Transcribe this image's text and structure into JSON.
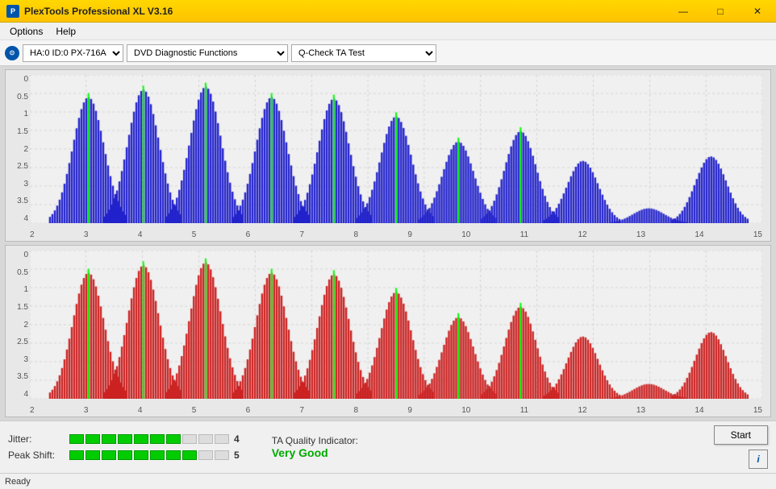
{
  "titleBar": {
    "title": "PlexTools Professional XL V3.16",
    "iconLabel": "P",
    "minimizeBtn": "—",
    "maximizeBtn": "□",
    "closeBtn": "✕"
  },
  "menuBar": {
    "items": [
      "Options",
      "Help"
    ]
  },
  "toolbar": {
    "deviceLabel": "HA:0 ID:0  PX-716A",
    "functionLabel": "DVD Diagnostic Functions",
    "testLabel": "Q-Check TA Test"
  },
  "charts": {
    "topChart": {
      "color": "#0000dd",
      "yLabels": [
        "0",
        "0.5",
        "1",
        "1.5",
        "2",
        "2.5",
        "3",
        "3.5",
        "4"
      ],
      "xLabels": [
        "2",
        "3",
        "4",
        "5",
        "6",
        "7",
        "8",
        "9",
        "10",
        "11",
        "12",
        "13",
        "14",
        "15"
      ]
    },
    "bottomChart": {
      "color": "#dd0000",
      "yLabels": [
        "0",
        "0.5",
        "1",
        "1.5",
        "2",
        "2.5",
        "3",
        "3.5",
        "4"
      ],
      "xLabels": [
        "2",
        "3",
        "4",
        "5",
        "6",
        "7",
        "8",
        "9",
        "10",
        "11",
        "12",
        "13",
        "14",
        "15"
      ]
    }
  },
  "metrics": {
    "jitter": {
      "label": "Jitter:",
      "filledSegs": 7,
      "totalSegs": 10,
      "value": "4"
    },
    "peakShift": {
      "label": "Peak Shift:",
      "filledSegs": 8,
      "totalSegs": 10,
      "value": "5"
    },
    "taQuality": {
      "label": "TA Quality Indicator:",
      "value": "Very Good"
    }
  },
  "buttons": {
    "start": "Start",
    "info": "i"
  },
  "statusBar": {
    "text": "Ready"
  }
}
